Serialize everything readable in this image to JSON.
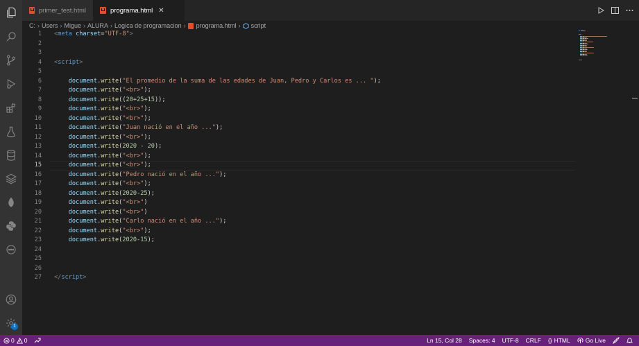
{
  "tabs": [
    {
      "label": "primer_test.html",
      "active": false
    },
    {
      "label": "programa.html",
      "active": true,
      "close": "✕"
    }
  ],
  "breadcrumb": [
    "C:",
    "Users",
    "Migue",
    "ALURA",
    "Logica de programacion",
    "programa.html",
    "script"
  ],
  "activity_icons": [
    "files-icon",
    "search-icon",
    "source-control-icon",
    "run-debug-icon",
    "extensions-icon",
    "testing-icon",
    "database-icon",
    "layers-icon",
    "mongodb-icon",
    "python-icon",
    "remote-explorer-icon",
    "account-icon",
    "settings-gear-icon"
  ],
  "settings_badge": "1",
  "editor": {
    "current_line": 15,
    "lines": [
      {
        "n": "1",
        "tokens": [
          [
            "tag",
            "<"
          ],
          [
            "tagname",
            "meta"
          ],
          [
            "punc",
            " "
          ],
          [
            "attr",
            "charset"
          ],
          [
            "punc",
            "="
          ],
          [
            "str",
            "\"UTF-8\""
          ],
          [
            "tag",
            ">"
          ]
        ]
      },
      {
        "n": "2",
        "tokens": []
      },
      {
        "n": "3",
        "tokens": []
      },
      {
        "n": "4",
        "tokens": [
          [
            "tag",
            "<"
          ],
          [
            "tagname",
            "script"
          ],
          [
            "tag",
            ">"
          ]
        ]
      },
      {
        "n": "5",
        "tokens": []
      },
      {
        "n": "6",
        "tokens": [
          [
            "punc",
            "    "
          ],
          [
            "var",
            "document"
          ],
          [
            "punc",
            "."
          ],
          [
            "fn",
            "write"
          ],
          [
            "punc",
            "("
          ],
          [
            "str",
            "\"El promedio de la suma de las edades de Juan, Pedro y Carlos es ... \""
          ],
          [
            "punc",
            ");"
          ]
        ]
      },
      {
        "n": "7",
        "tokens": [
          [
            "punc",
            "    "
          ],
          [
            "var",
            "document"
          ],
          [
            "punc",
            "."
          ],
          [
            "fn",
            "write"
          ],
          [
            "punc",
            "("
          ],
          [
            "str",
            "\"<br>\""
          ],
          [
            "punc",
            ");"
          ]
        ]
      },
      {
        "n": "8",
        "tokens": [
          [
            "punc",
            "    "
          ],
          [
            "var",
            "document"
          ],
          [
            "punc",
            "."
          ],
          [
            "fn",
            "write"
          ],
          [
            "punc",
            "(("
          ],
          [
            "num",
            "20"
          ],
          [
            "punc",
            "+"
          ],
          [
            "num",
            "25"
          ],
          [
            "punc",
            "+"
          ],
          [
            "num",
            "15"
          ],
          [
            "punc",
            "));"
          ]
        ]
      },
      {
        "n": "9",
        "tokens": [
          [
            "punc",
            "    "
          ],
          [
            "var",
            "document"
          ],
          [
            "punc",
            "."
          ],
          [
            "fn",
            "write"
          ],
          [
            "punc",
            "("
          ],
          [
            "str",
            "\"<br>\""
          ],
          [
            "punc",
            ");"
          ]
        ]
      },
      {
        "n": "10",
        "tokens": [
          [
            "punc",
            "    "
          ],
          [
            "var",
            "document"
          ],
          [
            "punc",
            "."
          ],
          [
            "fn",
            "write"
          ],
          [
            "punc",
            "("
          ],
          [
            "str",
            "\"<br>\""
          ],
          [
            "punc",
            ");"
          ]
        ]
      },
      {
        "n": "11",
        "tokens": [
          [
            "punc",
            "    "
          ],
          [
            "var",
            "document"
          ],
          [
            "punc",
            "."
          ],
          [
            "fn",
            "write"
          ],
          [
            "punc",
            "("
          ],
          [
            "str",
            "\"Juan nació en el año ...\""
          ],
          [
            "punc",
            ");"
          ]
        ]
      },
      {
        "n": "12",
        "tokens": [
          [
            "punc",
            "    "
          ],
          [
            "var",
            "document"
          ],
          [
            "punc",
            "."
          ],
          [
            "fn",
            "write"
          ],
          [
            "punc",
            "("
          ],
          [
            "str",
            "\"<br>\""
          ],
          [
            "punc",
            ");"
          ]
        ]
      },
      {
        "n": "13",
        "tokens": [
          [
            "punc",
            "    "
          ],
          [
            "var",
            "document"
          ],
          [
            "punc",
            "."
          ],
          [
            "fn",
            "write"
          ],
          [
            "punc",
            "("
          ],
          [
            "num",
            "2020"
          ],
          [
            "punc",
            " - "
          ],
          [
            "num",
            "20"
          ],
          [
            "punc",
            ");"
          ]
        ]
      },
      {
        "n": "14",
        "tokens": [
          [
            "punc",
            "    "
          ],
          [
            "var",
            "document"
          ],
          [
            "punc",
            "."
          ],
          [
            "fn",
            "write"
          ],
          [
            "punc",
            "("
          ],
          [
            "str",
            "\"<br>\""
          ],
          [
            "punc",
            ");"
          ]
        ]
      },
      {
        "n": "15",
        "tokens": [
          [
            "punc",
            "    "
          ],
          [
            "var",
            "document"
          ],
          [
            "punc",
            "."
          ],
          [
            "fn",
            "write"
          ],
          [
            "punc",
            "("
          ],
          [
            "str",
            "\"<br>\""
          ],
          [
            "punc",
            ");"
          ]
        ]
      },
      {
        "n": "16",
        "tokens": [
          [
            "punc",
            "    "
          ],
          [
            "var",
            "document"
          ],
          [
            "punc",
            "."
          ],
          [
            "fn",
            "write"
          ],
          [
            "punc",
            "("
          ],
          [
            "str",
            "\"Pedro nació en el año ...\""
          ],
          [
            "punc",
            ");"
          ]
        ]
      },
      {
        "n": "17",
        "tokens": [
          [
            "punc",
            "    "
          ],
          [
            "var",
            "document"
          ],
          [
            "punc",
            "."
          ],
          [
            "fn",
            "write"
          ],
          [
            "punc",
            "("
          ],
          [
            "str",
            "\"<br>\""
          ],
          [
            "punc",
            ");"
          ]
        ]
      },
      {
        "n": "18",
        "tokens": [
          [
            "punc",
            "    "
          ],
          [
            "var",
            "document"
          ],
          [
            "punc",
            "."
          ],
          [
            "fn",
            "write"
          ],
          [
            "punc",
            "("
          ],
          [
            "num",
            "2020"
          ],
          [
            "punc",
            "-"
          ],
          [
            "num",
            "25"
          ],
          [
            "punc",
            ");"
          ]
        ]
      },
      {
        "n": "19",
        "tokens": [
          [
            "punc",
            "    "
          ],
          [
            "var",
            "document"
          ],
          [
            "punc",
            "."
          ],
          [
            "fn",
            "write"
          ],
          [
            "punc",
            "("
          ],
          [
            "str",
            "\"<br>\""
          ],
          [
            "punc",
            ")"
          ]
        ]
      },
      {
        "n": "20",
        "tokens": [
          [
            "punc",
            "    "
          ],
          [
            "var",
            "document"
          ],
          [
            "punc",
            "."
          ],
          [
            "fn",
            "write"
          ],
          [
            "punc",
            "("
          ],
          [
            "str",
            "\"<br>\""
          ],
          [
            "punc",
            ")"
          ]
        ]
      },
      {
        "n": "21",
        "tokens": [
          [
            "punc",
            "    "
          ],
          [
            "var",
            "document"
          ],
          [
            "punc",
            "."
          ],
          [
            "fn",
            "write"
          ],
          [
            "punc",
            "("
          ],
          [
            "str",
            "\"Carlo nació en el año ...\""
          ],
          [
            "punc",
            ");"
          ]
        ]
      },
      {
        "n": "22",
        "tokens": [
          [
            "punc",
            "    "
          ],
          [
            "var",
            "document"
          ],
          [
            "punc",
            "."
          ],
          [
            "fn",
            "write"
          ],
          [
            "punc",
            "("
          ],
          [
            "str",
            "\"<br>\""
          ],
          [
            "punc",
            ");"
          ]
        ]
      },
      {
        "n": "23",
        "tokens": [
          [
            "punc",
            "    "
          ],
          [
            "var",
            "document"
          ],
          [
            "punc",
            "."
          ],
          [
            "fn",
            "write"
          ],
          [
            "punc",
            "("
          ],
          [
            "num",
            "2020"
          ],
          [
            "punc",
            "-"
          ],
          [
            "num",
            "15"
          ],
          [
            "punc",
            ");"
          ]
        ]
      },
      {
        "n": "24",
        "tokens": []
      },
      {
        "n": "25",
        "tokens": []
      },
      {
        "n": "26",
        "tokens": []
      },
      {
        "n": "27",
        "tokens": [
          [
            "tag",
            "</"
          ],
          [
            "tagname",
            "script"
          ],
          [
            "tag",
            ">"
          ]
        ]
      }
    ]
  },
  "statusbar": {
    "errors": "0",
    "warnings": "0",
    "position": "Ln 15, Col 28",
    "spaces": "Spaces: 4",
    "encoding": "UTF-8",
    "eol": "CRLF",
    "language": "HTML",
    "golive": "Go Live"
  },
  "colors": {
    "statusbar": "#68217a",
    "editor_bg": "#1e1e1e",
    "activitybar": "#333333"
  }
}
